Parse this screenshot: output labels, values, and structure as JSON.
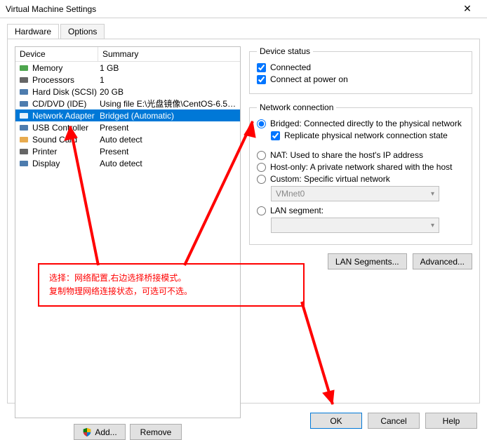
{
  "window": {
    "title": "Virtual Machine Settings",
    "close": "✕"
  },
  "tabs": {
    "hardware": "Hardware",
    "options": "Options"
  },
  "devlist": {
    "hdr_device": "Device",
    "hdr_summary": "Summary",
    "rows": [
      {
        "icon": "memory",
        "name": "Memory",
        "summary": "1 GB"
      },
      {
        "icon": "cpu",
        "name": "Processors",
        "summary": "1"
      },
      {
        "icon": "hdd",
        "name": "Hard Disk (SCSI)",
        "summary": "20 GB"
      },
      {
        "icon": "cd",
        "name": "CD/DVD (IDE)",
        "summary": "Using file E:\\光盘镜像\\CentOS-6.5-..."
      },
      {
        "icon": "net",
        "name": "Network Adapter",
        "summary": "Bridged (Automatic)"
      },
      {
        "icon": "usb",
        "name": "USB Controller",
        "summary": "Present"
      },
      {
        "icon": "sound",
        "name": "Sound Card",
        "summary": "Auto detect"
      },
      {
        "icon": "printer",
        "name": "Printer",
        "summary": "Present"
      },
      {
        "icon": "display",
        "name": "Display",
        "summary": "Auto detect"
      }
    ],
    "add": "Add...",
    "remove": "Remove"
  },
  "status": {
    "legend": "Device status",
    "connected": "Connected",
    "connect_power": "Connect at power on"
  },
  "netconn": {
    "legend": "Network connection",
    "bridged": "Bridged: Connected directly to the physical network",
    "replicate": "Replicate physical network connection state",
    "nat": "NAT: Used to share the host's IP address",
    "hostonly": "Host-only: A private network shared with the host",
    "custom": "Custom: Specific virtual network",
    "vmnet": "VMnet0",
    "lanseg": "LAN segment:",
    "lanseg_val": ""
  },
  "rightbtns": {
    "lansegments": "LAN Segments...",
    "advanced": "Advanced..."
  },
  "bottom": {
    "ok": "OK",
    "cancel": "Cancel",
    "help": "Help"
  },
  "annotation": {
    "line1": "选择：网络配置,右边选择桥接模式。",
    "line2": "复制物理网络连接状态，可选可不选。"
  },
  "icons": {
    "memory": "#3a9b3a",
    "cpu": "#555",
    "hdd": "#3a6ea5",
    "cd": "#3a6ea5",
    "net": "#3a6ea5",
    "usb": "#3a6ea5",
    "sound": "#e6a23c",
    "printer": "#555",
    "display": "#3a6ea5"
  }
}
